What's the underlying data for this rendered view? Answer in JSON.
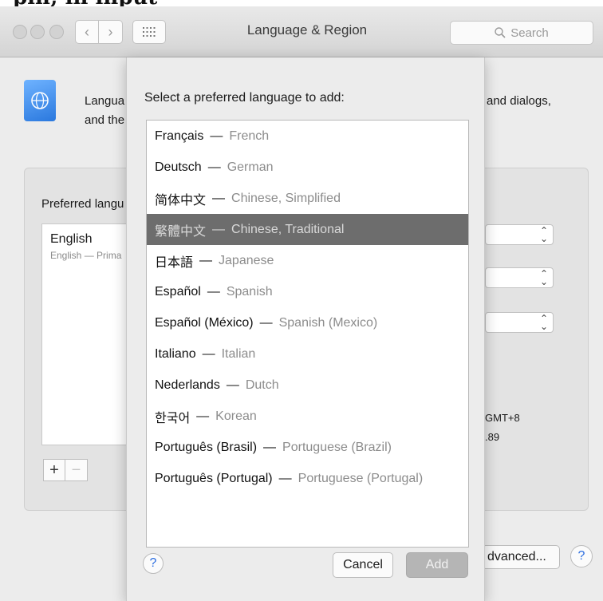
{
  "caption": "pin; in input",
  "window": {
    "title": "Language & Region",
    "search_placeholder": "Search",
    "search_icon": "magnifier-icon",
    "grid_icon": "grid-icon"
  },
  "background": {
    "description_line1_start": "Langua",
    "description_line1_end": "and dialogs,",
    "description_line2_start": "and the",
    "preferred_label": "Preferred langu",
    "preferred_list": {
      "item_title": "English",
      "item_subtitle": "English — Prima"
    },
    "add_symbol": "+",
    "remove_symbol": "−",
    "gmt_text": "GMT+8",
    "number_text": ".89",
    "advanced_label": "dvanced...",
    "help_symbol": "?"
  },
  "sheet": {
    "prompt": "Select a preferred language to add:",
    "languages": [
      {
        "native": "Français",
        "english": "French",
        "selected": false
      },
      {
        "native": "Deutsch",
        "english": "German",
        "selected": false
      },
      {
        "native": "简体中文",
        "english": "Chinese, Simplified",
        "selected": false
      },
      {
        "native": "繁體中文",
        "english": "Chinese, Traditional",
        "selected": true
      },
      {
        "native": "日本語",
        "english": "Japanese",
        "selected": false
      },
      {
        "native": "Español",
        "english": "Spanish",
        "selected": false
      },
      {
        "native": "Español (México)",
        "english": "Spanish (Mexico)",
        "selected": false
      },
      {
        "native": "Italiano",
        "english": "Italian",
        "selected": false
      },
      {
        "native": "Nederlands",
        "english": "Dutch",
        "selected": false
      },
      {
        "native": "한국어",
        "english": "Korean",
        "selected": false
      },
      {
        "native": "Português (Brasil)",
        "english": "Portuguese (Brazil)",
        "selected": false
      },
      {
        "native": "Português (Portugal)",
        "english": "Portuguese (Portugal)",
        "selected": false
      }
    ],
    "dash": "—",
    "help_symbol": "?",
    "cancel_label": "Cancel",
    "add_label": "Add"
  }
}
